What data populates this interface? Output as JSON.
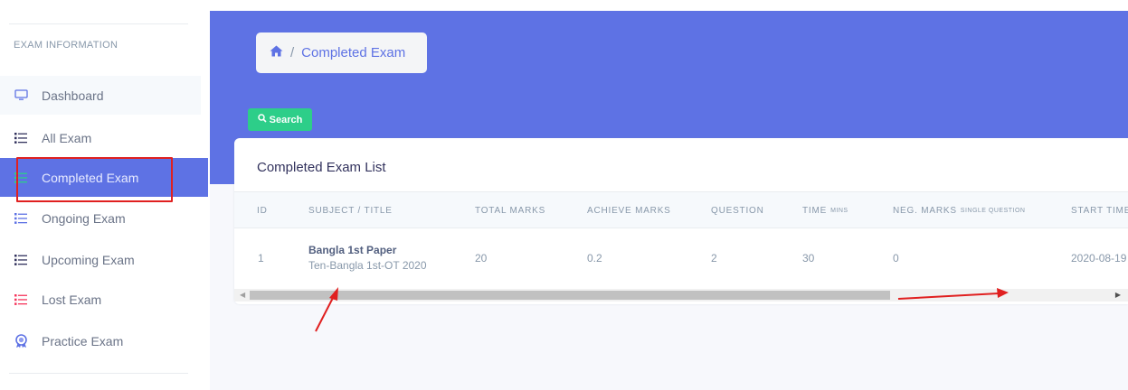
{
  "sidebar": {
    "heading": "EXAM INFORMATION",
    "items": [
      {
        "label": "Dashboard",
        "icon": "monitor-icon",
        "icon_color": "#5e72e4"
      },
      {
        "label": "All Exam",
        "icon": "list-icon",
        "icon_color": "#32325d"
      },
      {
        "label": "Completed Exam",
        "icon": "list-icon",
        "icon_color": "#2dce89"
      },
      {
        "label": "Ongoing Exam",
        "icon": "list-icon",
        "icon_color": "#5e72e4"
      },
      {
        "label": "Upcoming Exam",
        "icon": "list-icon",
        "icon_color": "#32325d"
      },
      {
        "label": "Lost Exam",
        "icon": "list-icon",
        "icon_color": "#f5365c"
      },
      {
        "label": "Practice Exam",
        "icon": "badge-icon",
        "icon_color": "#5e72e4"
      }
    ],
    "active_index": 2
  },
  "breadcrumb": {
    "home_icon": "home-icon",
    "separator": "/",
    "current": "Completed Exam"
  },
  "toolbar": {
    "search_label": "Search",
    "search_icon": "search-icon"
  },
  "card": {
    "title": "Completed Exam List",
    "columns": [
      {
        "label": "ID",
        "sub": ""
      },
      {
        "label": "SUBJECT / TITLE",
        "sub": ""
      },
      {
        "label": "TOTAL MARKS",
        "sub": ""
      },
      {
        "label": "ACHIEVE MARKS",
        "sub": ""
      },
      {
        "label": "QUESTION",
        "sub": ""
      },
      {
        "label": "TIME",
        "sub": "MINS"
      },
      {
        "label": "NEG. MARKS",
        "sub": "SINGLE QUESTION"
      },
      {
        "label": "START TIME",
        "sub": ""
      }
    ],
    "rows": [
      {
        "id": "1",
        "subject_title": "Bangla 1st Paper",
        "subject_sub": "Ten-Bangla 1st-OT 2020",
        "total_marks": "20",
        "achieve_marks": "0.2",
        "question": "2",
        "time": "30",
        "neg_marks": "0",
        "start_time": "2020-08-19"
      }
    ]
  },
  "colors": {
    "primary": "#5e72e4",
    "success": "#2dce89",
    "annotation_red": "#e02020"
  }
}
